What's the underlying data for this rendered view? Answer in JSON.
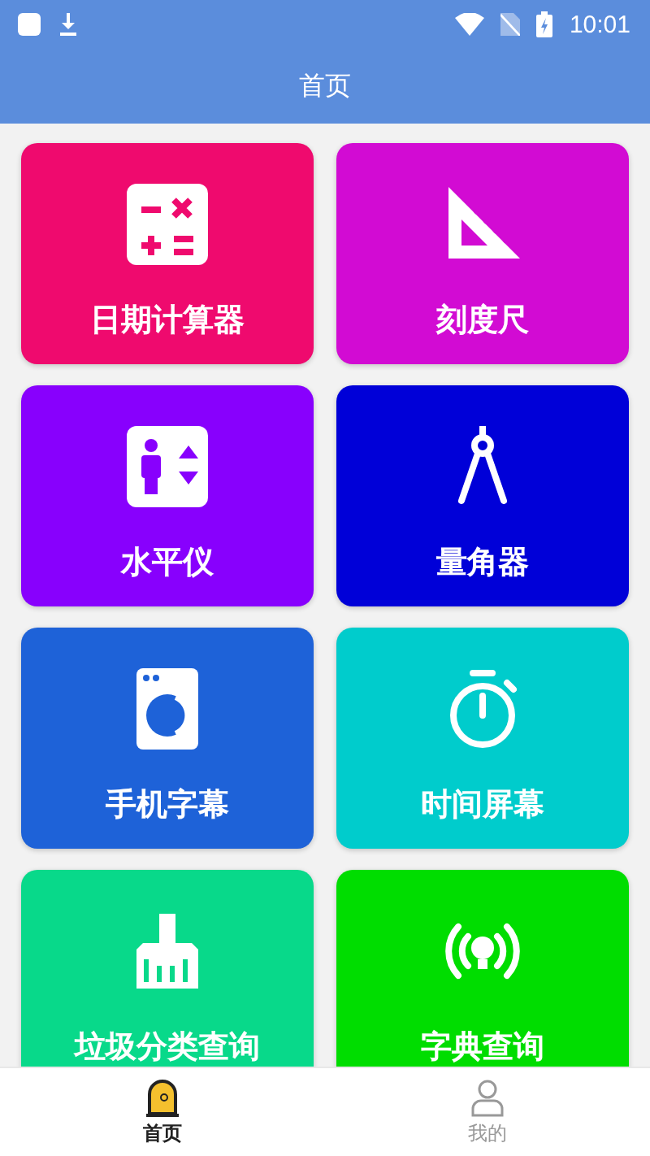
{
  "status_bar": {
    "time": "10:01"
  },
  "app_bar": {
    "title": "首页"
  },
  "tiles": [
    {
      "label": "日期计算器",
      "color": "#ef0a6e"
    },
    {
      "label": "刻度尺",
      "color": "#d20bd3"
    },
    {
      "label": "水平仪",
      "color": "#8800fd"
    },
    {
      "label": "量角器",
      "color": "#0000d8"
    },
    {
      "label": "手机字幕",
      "color": "#1e62d8"
    },
    {
      "label": "时间屏幕",
      "color": "#00cccc"
    },
    {
      "label": "垃圾分类查询",
      "color": "#08d98a"
    },
    {
      "label": "字典查询",
      "color": "#00dd00"
    }
  ],
  "bottom_nav": [
    {
      "label": "首页",
      "selected": true
    },
    {
      "label": "我的",
      "selected": false
    }
  ]
}
